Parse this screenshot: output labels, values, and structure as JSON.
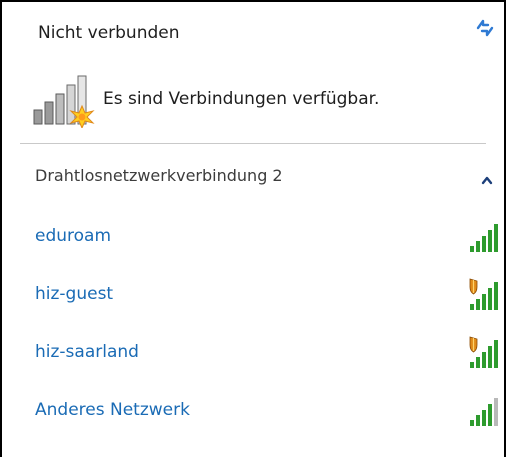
{
  "status": {
    "title": "Nicht verbunden",
    "summary": "Es sind Verbindungen verfügbar."
  },
  "icons": {
    "refresh": "refresh-icon",
    "summary": "network-no-connection-icon",
    "collapse": "chevron-up-icon",
    "signal": "signal-strength-icon",
    "secured": "security-shield-icon"
  },
  "group": {
    "label": "Drahtlosnetzwerkverbindung 2",
    "expanded": true
  },
  "networks": [
    {
      "name": "eduroam",
      "secured": false,
      "signal_bars": 5
    },
    {
      "name": "hiz-guest",
      "secured": true,
      "signal_bars": 5
    },
    {
      "name": "hiz-saarland",
      "secured": true,
      "signal_bars": 5
    },
    {
      "name": "Anderes Netzwerk",
      "secured": false,
      "signal_bars": 4
    }
  ],
  "colors": {
    "link": "#1a6bb5",
    "signal_on": "#2e9b2e",
    "signal_off": "#b9b9b9",
    "shield": "#e08a1a",
    "chevron": "#1c3f7a"
  }
}
